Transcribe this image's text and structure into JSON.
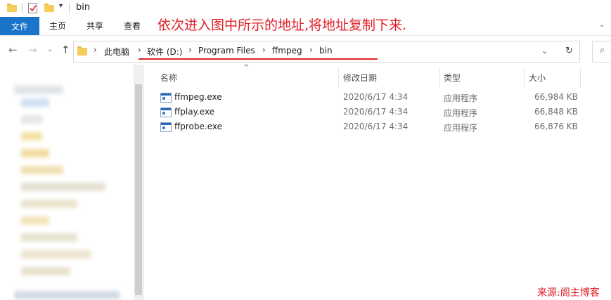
{
  "window": {
    "title": "bin"
  },
  "ribbon": {
    "tabs": [
      "文件",
      "主页",
      "共享",
      "查看"
    ]
  },
  "annotation": "依次进入图中所示的地址,将地址复制下来.",
  "address": {
    "crumbs": [
      "此电脑",
      "软件 (D:)",
      "Program Files",
      "ffmpeg",
      "bin"
    ]
  },
  "columns": {
    "name": "名称",
    "modified": "修改日期",
    "type": "类型",
    "size": "大小"
  },
  "files": [
    {
      "name": "ffmpeg.exe",
      "modified": "2020/6/17 4:34",
      "type": "应用程序",
      "size": "66,984 KB"
    },
    {
      "name": "ffplay.exe",
      "modified": "2020/6/17 4:34",
      "type": "应用程序",
      "size": "66,848 KB"
    },
    {
      "name": "ffprobe.exe",
      "modified": "2020/6/17 4:34",
      "type": "应用程序",
      "size": "66,876 KB"
    }
  ],
  "watermark": "来源:阁主博客",
  "icons": {
    "quick_access": [
      "folder-icon",
      "properties-check-icon",
      "new-folder-icon",
      "dropdown-icon"
    ],
    "nav": [
      "back-arrow-icon",
      "forward-arrow-icon",
      "recent-dropdown-icon",
      "up-arrow-icon"
    ],
    "address": [
      "folder-icon",
      "chevron-right-icon",
      "address-dropdown-icon",
      "refresh-icon",
      "search-icon"
    ],
    "file": "exe-file-icon"
  },
  "colors": {
    "file_tab": "#1a74c9",
    "annotation": "#e0202a",
    "folder": "#f5cd5a"
  }
}
